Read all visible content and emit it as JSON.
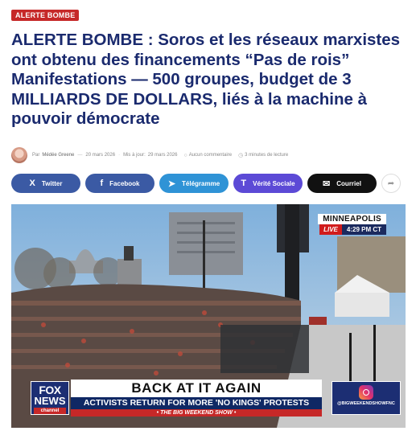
{
  "badge": "ALERTE BOMBE",
  "headline": "ALERTE BOMBE : Soros et les réseaux marxistes ont obtenu des financements “Pas de rois” Manifestations — 500 groupes, budget de 3 MILLIARDS DE DOLLARS, liés à la machine à pouvoir démocrate",
  "meta": {
    "by": "Par",
    "author": "Médée Greene",
    "date": "20 mars 2026",
    "updated_label": "Mis à jour:",
    "updated": "29 mars 2026",
    "comments": "Aucun commentaire",
    "read_time": "3 minutes de lecture"
  },
  "share": {
    "x": "Twitter",
    "facebook": "Facebook",
    "telegram": "Télégramme",
    "truth": "Vérité Sociale",
    "mail": "Courriel"
  },
  "icons": [
    "avatar",
    "calendar-icon",
    "clock-icon",
    "comment-icon",
    "x-icon",
    "facebook-icon",
    "telegram-icon",
    "truth-icon",
    "mail-icon",
    "share-icon"
  ],
  "video": {
    "location": "MINNEAPOLIS",
    "live": "LIVE",
    "time": "4:29 PM CT",
    "headline": "BACK AT IT AGAIN",
    "subhead": "ACTIVISTS RETURN FOR MORE 'NO KINGS' PROTESTS",
    "show": "• THE BIG WEEKEND SHOW •",
    "network_1": "FOX",
    "network_2": "NEWS",
    "network_3": "channel",
    "handle": "@BIGWEEKENDSHOWFNC"
  },
  "colors": {
    "headline": "#1a2a6e",
    "badge": "#c62828",
    "twitter": "#3b5aa4",
    "facebook": "#3b5aa4",
    "telegram": "#2f93d6",
    "truth": "#5c4ad6",
    "mail": "#111111"
  }
}
